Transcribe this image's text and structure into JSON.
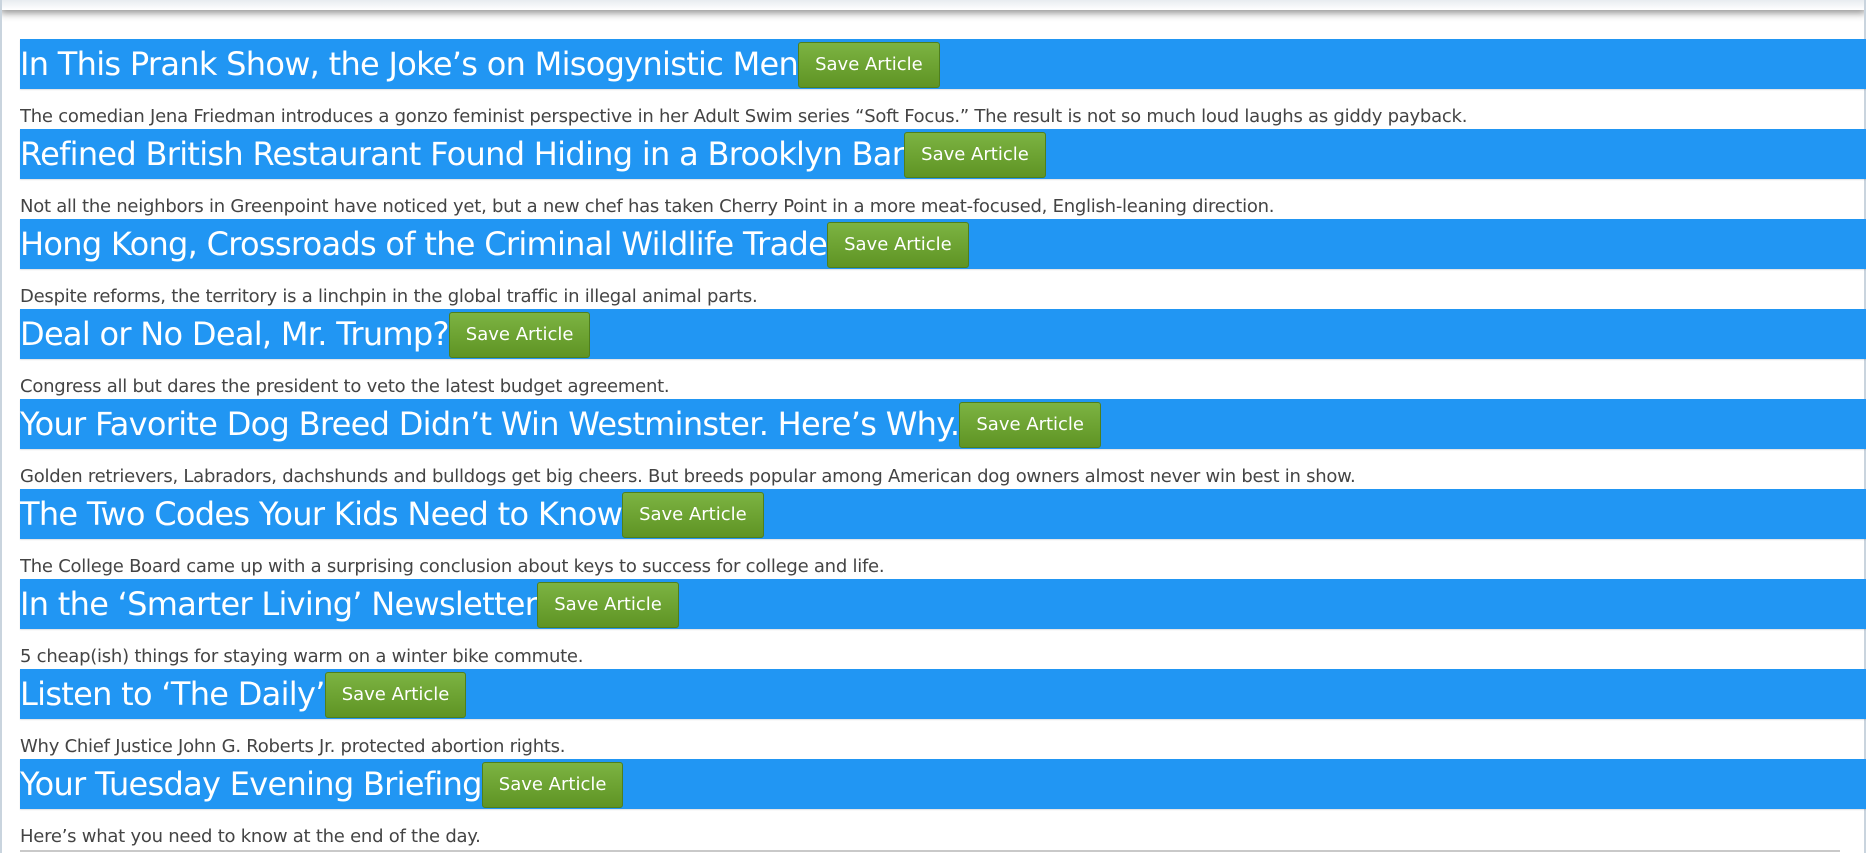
{
  "save_label": "Save Article",
  "articles": [
    {
      "headline": "In This Prank Show, the Joke’s on Misogynistic Men",
      "summary": "The comedian Jena Friedman introduces a gonzo feminist perspective in her Adult Swim series “Soft Focus.” The result is not so much loud laughs as giddy payback."
    },
    {
      "headline": "Refined British Restaurant Found Hiding in a Brooklyn Bar",
      "summary": "Not all the neighbors in Greenpoint have noticed yet, but a new chef has taken Cherry Point in a more meat-focused, English-leaning direction."
    },
    {
      "headline": "Hong Kong, Crossroads of the Criminal Wildlife Trade",
      "summary": "Despite reforms, the territory is a linchpin in the global traffic in illegal animal parts."
    },
    {
      "headline": "Deal or No Deal, Mr. Trump?",
      "summary": "Congress all but dares the president to veto the latest budget agreement."
    },
    {
      "headline": "Your Favorite Dog Breed Didn’t Win Westminster. Here’s Why.",
      "summary": "Golden retrievers, Labradors, dachshunds and bulldogs get big cheers. But breeds popular among American dog owners almost never win best in show."
    },
    {
      "headline": "The Two Codes Your Kids Need to Know",
      "summary": "The College Board came up with a surprising conclusion about keys to success for college and life."
    },
    {
      "headline": "In the ‘Smarter Living’ Newsletter",
      "summary": "5 cheap(ish) things for staying warm on a winter bike commute."
    },
    {
      "headline": "Listen to ‘The Daily’",
      "summary": "Why Chief Justice John G. Roberts Jr. protected abortion rights."
    },
    {
      "headline": "Your Tuesday Evening Briefing",
      "summary": "Here’s what you need to know at the end of the day."
    }
  ]
}
